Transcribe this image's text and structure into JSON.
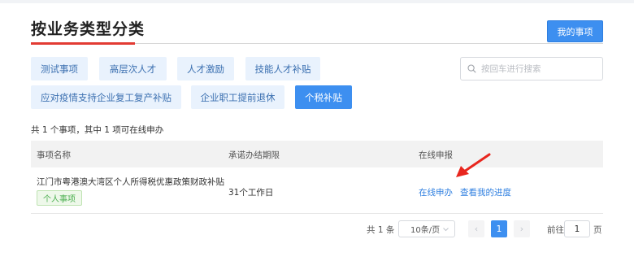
{
  "header": {
    "title": "按业务类型分类",
    "my_items_label": "我的事项"
  },
  "categories": [
    {
      "label": "测试事项",
      "active": false
    },
    {
      "label": "高层次人才",
      "active": false
    },
    {
      "label": "人才激励",
      "active": false
    },
    {
      "label": "技能人才补贴",
      "active": false
    },
    {
      "label": "应对疫情支持企业复工复产补贴",
      "active": false
    },
    {
      "label": "企业职工提前退休",
      "active": false
    },
    {
      "label": "个税补贴",
      "active": true
    }
  ],
  "search": {
    "placeholder": "按回车进行搜索",
    "value": ""
  },
  "summary": "共 1 个事项，其中 1 项可在线申办",
  "table": {
    "columns": [
      "事项名称",
      "承诺办结期限",
      "在线申报"
    ],
    "rows": [
      {
        "name": "江门市粤港澳大湾区个人所得税优惠政策财政补贴",
        "badge": "个人事项",
        "deadline": "31个工作日",
        "actions": [
          "在线申办",
          "查看我的进度"
        ]
      }
    ]
  },
  "pagination": {
    "total_text": "共 1 条",
    "page_size": "10条/页",
    "prev": "‹",
    "current_page": "1",
    "next": "›",
    "goto_label": "前往",
    "goto_value": "1",
    "goto_unit": "页"
  },
  "colors": {
    "primary": "#3d8ff0",
    "accent_red": "#e23b33",
    "tag_bg": "#e9f2fd",
    "badge_green": "#4caf50"
  },
  "icons": {
    "search": "search-icon",
    "dropdown": "chevron-down-icon",
    "annotation": "red-arrow"
  }
}
